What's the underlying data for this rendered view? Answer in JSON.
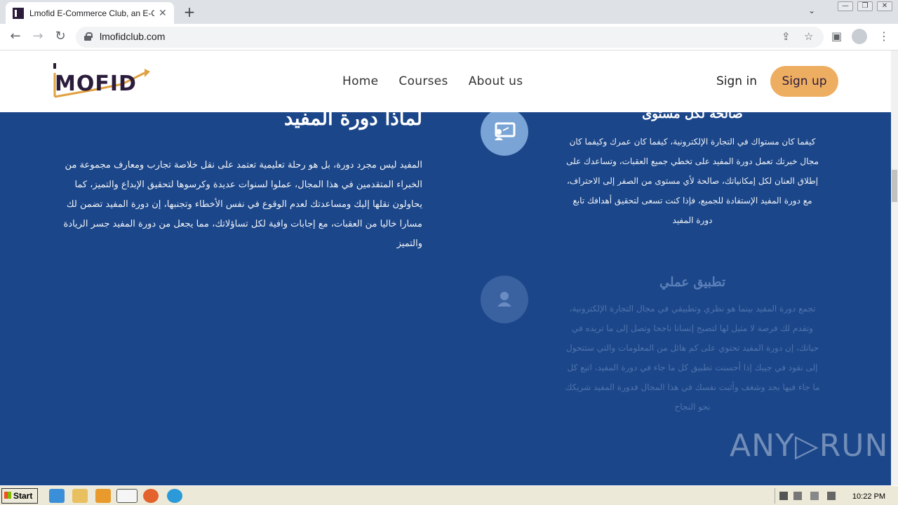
{
  "browser": {
    "tab_title": "Lmofid E-Commerce Club, an E-Commerce",
    "tab_close": "✕",
    "new_tab": "+",
    "url": "lmofidclub.com",
    "back": "←",
    "forward": "→",
    "reload": "↻",
    "share": "⇪",
    "bookmark": "☆",
    "side_panel": "▣",
    "menu": "⋮",
    "tab_search": "⌄",
    "win_min": "—",
    "win_max": "❐",
    "win_close": "✕"
  },
  "site": {
    "logo_text": "MOFID",
    "nav": [
      "Home",
      "Courses",
      "About us"
    ],
    "sign_in": "Sign in",
    "sign_up": "Sign up"
  },
  "why": {
    "title": "لماذا دورة المفيد",
    "paragraph": "المفيد ليس مجرد دورة، بل هو رحلة تعليمية تعتمد على نقل خلاصة تجارب ومعارف مجموعة من الخبراء المتقدمين في هذا المجال، عملوا لسنوات عديدة وكرسوها لتحقيق الإبداع والتميز، كما يحاولون نقلها إليك ومساعدتك لعدم الوقوع في نفس الأخطاء وتجنبها، إن دورة المفيد تضمن لك مسارا خاليا من العقبات، مع إجابات وافية لكل تساؤلاتك، مما يجعل من دورة المفيد جسر الريادة والتميز"
  },
  "features": [
    {
      "icon": "presentation-icon",
      "title": "صالحة لكل مستوى",
      "text": "كيفما كان مستواك في التجارة الإلكترونية، كيفما كان عمرك وكيفما كان مجال خبرتك تعمل دورة المفيد على تخطي جميع العقبات، وتساعدك على إطلاق العنان لكل إمكانياتك، صالحة لأي مستوى من الصفر إلى الاحتراف، مع دورة المفيد الإستفادة للجميع، فإذا كنت تسعى لتحقيق أهدافك تابع دورة المفيد"
    },
    {
      "icon": "user-icon",
      "title": "تطبيق عملي",
      "text": "تجمع دورة المفيد بينما هو نظري وتطبيقي في مجال التجارة الإلكترونية، وتقدم لك فرصة لا مثيل لها لتصبح إنسانا ناجحا وتصل إلى ما تريده في حياتك، إن دورة المفيد تحتوي على كم هائل من المعلومات والتي ستتحول إلى نقود في جيبك إذا أحسنت تطبيق كل ما جاء في دورة المفيد، اتبع كل ما جاء فيها بجد وشغف وأثبت نفسك في هذا المجال فدورة المفيد شريكك نحو النجاح"
    }
  ],
  "watermark": "ANY▷RUN",
  "taskbar": {
    "start": "Start",
    "clock": "10:22 PM"
  },
  "colors": {
    "content_bg": "#1b4689",
    "signup_bg": "#eeae62",
    "logo": "#2b1c3c"
  }
}
